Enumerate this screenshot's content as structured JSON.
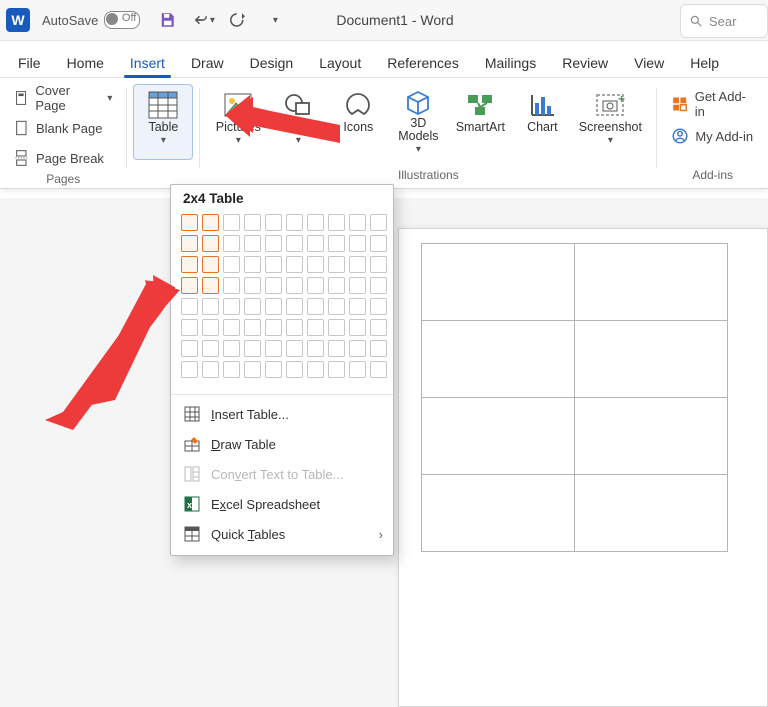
{
  "titlebar": {
    "autosave_label": "AutoSave",
    "autosave_state": "Off",
    "doc_title": "Document1 - Word",
    "search_placeholder": "Sear"
  },
  "tabs": {
    "file": "File",
    "home": "Home",
    "insert": "Insert",
    "draw": "Draw",
    "design": "Design",
    "layout": "Layout",
    "references": "References",
    "mailings": "Mailings",
    "review": "Review",
    "view": "View",
    "help": "Help"
  },
  "ribbon": {
    "pages": {
      "cover_page": "Cover Page",
      "blank_page": "Blank Page",
      "page_break": "Page Break",
      "group": "Pages"
    },
    "table_btn": "Table",
    "illustrations": {
      "pictures": "Pictures",
      "shapes": "Shapes",
      "icons": "Icons",
      "models": "3D Models",
      "smartart": "SmartArt",
      "chart": "Chart",
      "screenshot": "Screenshot",
      "group": "Illustrations"
    },
    "addins": {
      "get": "Get Add-in",
      "my": "My Add-in",
      "group": "Add-ins"
    }
  },
  "dropdown": {
    "title": "2x4 Table",
    "sel_cols": 2,
    "sel_rows": 4,
    "insert_table": "Insert Table...",
    "draw_table": "Draw Table",
    "convert": "Convert Text to Table...",
    "excel": "Excel Spreadsheet",
    "quick": "Quick Tables"
  }
}
